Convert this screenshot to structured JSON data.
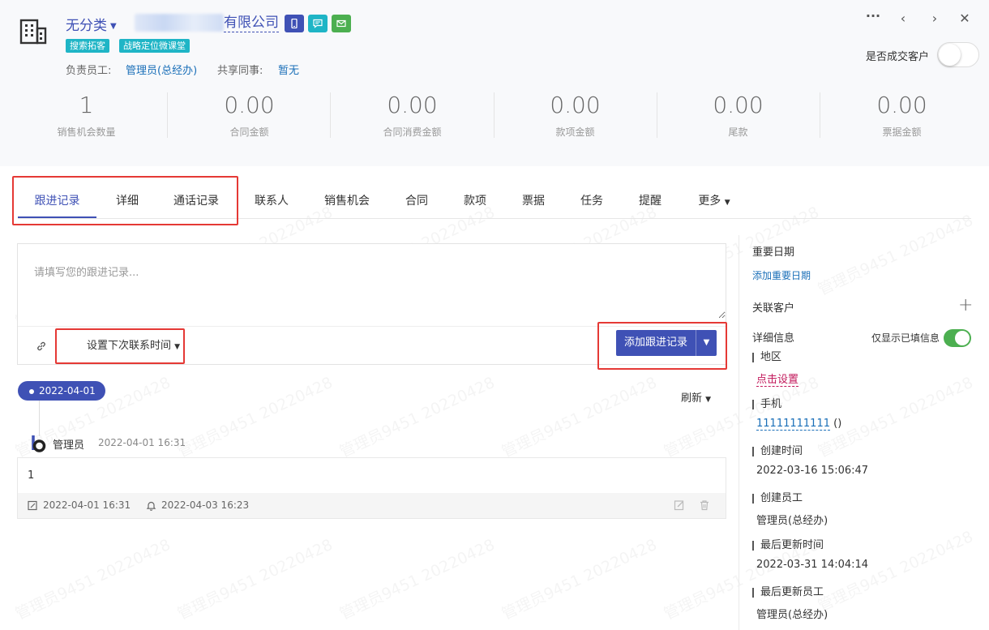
{
  "header": {
    "category": "无分类",
    "company_name_visible": "有限公司",
    "tags": [
      "搜索拓客",
      "战略定位微课堂"
    ],
    "owner_label": "负责员工:",
    "owner_value": "管理员(总经办)",
    "shared_label": "共享同事:",
    "shared_value": "暂无",
    "deal_label": "是否成交客户",
    "deal_toggle": false,
    "quick_icons": [
      "mobile-icon",
      "chat-icon",
      "mail-icon"
    ],
    "controls": [
      "more-icon",
      "prev-icon",
      "next-icon",
      "close-icon"
    ]
  },
  "stats": [
    {
      "value": "1",
      "label": "销售机会数量"
    },
    {
      "value": "0.00",
      "label": "合同金额"
    },
    {
      "value": "0.00",
      "label": "合同消费金额"
    },
    {
      "value": "0.00",
      "label": "款项金额"
    },
    {
      "value": "0.00",
      "label": "尾款"
    },
    {
      "value": "0.00",
      "label": "票据金额"
    }
  ],
  "tabs": [
    "跟进记录",
    "详细",
    "通话记录",
    "联系人",
    "销售机会",
    "合同",
    "款项",
    "票据",
    "任务",
    "提醒",
    "更多"
  ],
  "active_tab": "跟进记录",
  "editor": {
    "placeholder": "请填写您的跟进记录...",
    "next_contact": "设置下次联系时间",
    "add_button": "添加跟进记录"
  },
  "timeline": {
    "date": "2022-04-01",
    "refresh": "刷新",
    "record": {
      "user": "管理员",
      "time": "2022-04-01 16:31",
      "content": "1",
      "edited_time": "2022-04-01 16:31",
      "reminder_time": "2022-04-03 16:23"
    }
  },
  "sidebar": {
    "important_dates_title": "重要日期",
    "add_important_date": "添加重要日期",
    "related_customers_title": "关联客户",
    "details_title": "详细信息",
    "only_filled_label": "仅显示已填信息",
    "only_filled_toggle": true,
    "fields": [
      {
        "label": "地区",
        "value": "点击设置"
      },
      {
        "label": "手机",
        "value": "11111111111",
        "suffix": " ()"
      },
      {
        "label": "创建时间",
        "value": "2022-03-16 15:06:47"
      },
      {
        "label": "创建员工",
        "value": "管理员(总经办)"
      },
      {
        "label": "最后更新时间",
        "value": "2022-03-31 14:04:14"
      },
      {
        "label": "最后更新员工",
        "value": "管理员(总经办)"
      }
    ]
  },
  "watermark": "管理员9451 20220428",
  "colors": {
    "primary": "#3f51b5",
    "tag": "#1fb5c6",
    "toggle_on": "#4caf50",
    "highlight_box": "#e53935"
  }
}
